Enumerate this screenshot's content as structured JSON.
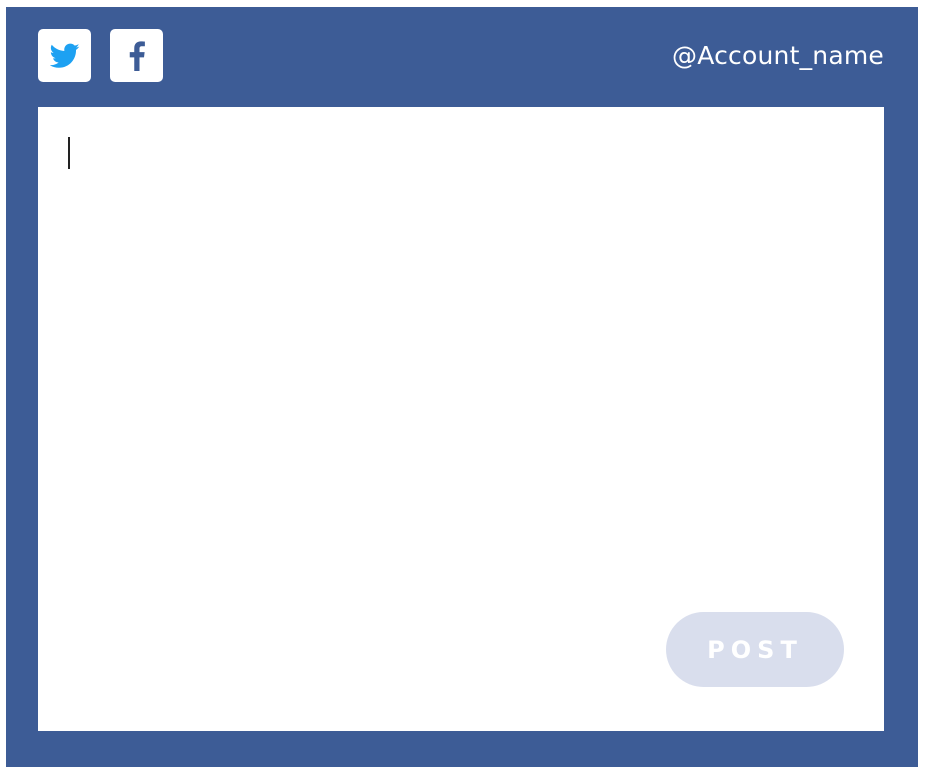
{
  "header": {
    "networks": [
      {
        "name": "Twitter",
        "icon": "twitter-bird-icon",
        "color": "#1da1f2"
      },
      {
        "name": "Facebook",
        "icon": "facebook-f-icon",
        "color": "#3d5c96"
      }
    ],
    "account_name": "@Account_name"
  },
  "composer": {
    "value": "",
    "placeholder": "",
    "post_label": "POST",
    "post_enabled": false
  },
  "colors": {
    "panel_bg": "#3d5c96",
    "post_button_disabled_bg": "#d9deed",
    "text_light": "#ffffff"
  }
}
